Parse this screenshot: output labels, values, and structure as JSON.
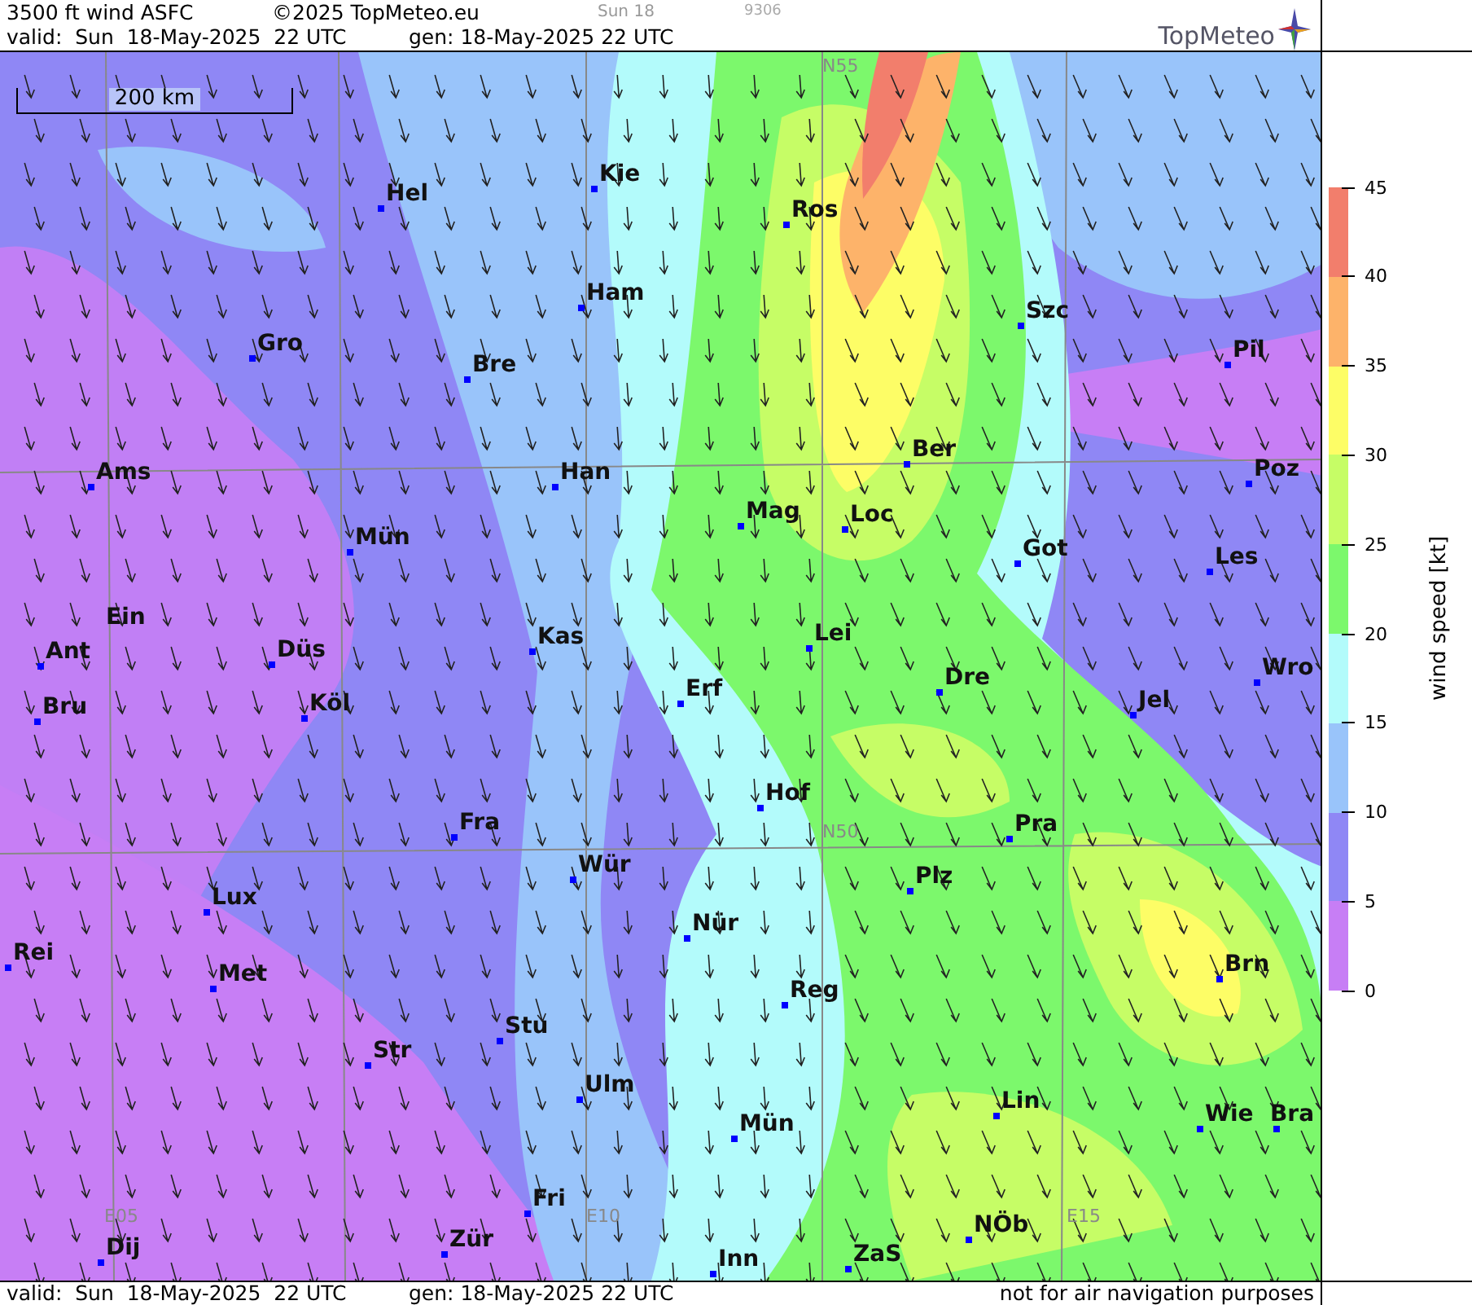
{
  "header": {
    "title": "3500 ft wind ASFC",
    "copyright": "©2025 TopMeteo.eu",
    "day": "Sun 18",
    "code": "9306",
    "valid": "valid:  Sun  18-May-2025  22 UTC",
    "generated": "gen: 18-May-2025 22 UTC",
    "logo": "TopMeteo"
  },
  "map": {
    "scale": "200 km",
    "grid_labels": [
      "N55",
      "N50",
      "E05",
      "E10",
      "E15"
    ],
    "cities": [
      {
        "name": "Hel"
      },
      {
        "name": "Kie"
      },
      {
        "name": "Ros"
      },
      {
        "name": "Gro"
      },
      {
        "name": "Ham"
      },
      {
        "name": "Szc"
      },
      {
        "name": "Pil"
      },
      {
        "name": "Bre"
      },
      {
        "name": "Ams"
      },
      {
        "name": "Han"
      },
      {
        "name": "Ber"
      },
      {
        "name": "Poz"
      },
      {
        "name": "Mün"
      },
      {
        "name": "Mag"
      },
      {
        "name": "Loc"
      },
      {
        "name": "Got"
      },
      {
        "name": "Les"
      },
      {
        "name": "Ein"
      },
      {
        "name": "Ant"
      },
      {
        "name": "Düs"
      },
      {
        "name": "Kas"
      },
      {
        "name": "Lei"
      },
      {
        "name": "Erf"
      },
      {
        "name": "Dre"
      },
      {
        "name": "Jel"
      },
      {
        "name": "Wro"
      },
      {
        "name": "Bru"
      },
      {
        "name": "Köl"
      },
      {
        "name": "Hof"
      },
      {
        "name": "Fra"
      },
      {
        "name": "Pra"
      },
      {
        "name": "Wür"
      },
      {
        "name": "Plz"
      },
      {
        "name": "Lux"
      },
      {
        "name": "Nür"
      },
      {
        "name": "Rei"
      },
      {
        "name": "Met"
      },
      {
        "name": "Reg"
      },
      {
        "name": "Brn"
      },
      {
        "name": "Stu"
      },
      {
        "name": "Str"
      },
      {
        "name": "Ulm"
      },
      {
        "name": "Lin"
      },
      {
        "name": "Wie"
      },
      {
        "name": "Bra"
      },
      {
        "name": "Mün"
      },
      {
        "name": "Fri"
      },
      {
        "name": "Dij"
      },
      {
        "name": "Zür"
      },
      {
        "name": "Inn"
      },
      {
        "name": "ZaS"
      },
      {
        "name": "NÖb"
      }
    ]
  },
  "legend": {
    "title": "wind speed [kt]",
    "ticks": [
      "45",
      "40",
      "35",
      "30",
      "25",
      "20",
      "15",
      "10",
      "5",
      "0"
    ],
    "bands": [
      {
        "color": "#f27e6c"
      },
      {
        "color": "#fdb36a"
      },
      {
        "color": "#fdfd66"
      },
      {
        "color": "#c6fd66"
      },
      {
        "color": "#7cf86c"
      },
      {
        "color": "#b3fbfb"
      },
      {
        "color": "#99c4fa"
      },
      {
        "color": "#8f87f5"
      },
      {
        "color": "#c77ef5"
      }
    ]
  },
  "footer": {
    "valid": "valid:  Sun  18-May-2025  22 UTC",
    "generated": "gen: 18-May-2025 22 UTC",
    "notice": "not for air navigation purposes"
  }
}
